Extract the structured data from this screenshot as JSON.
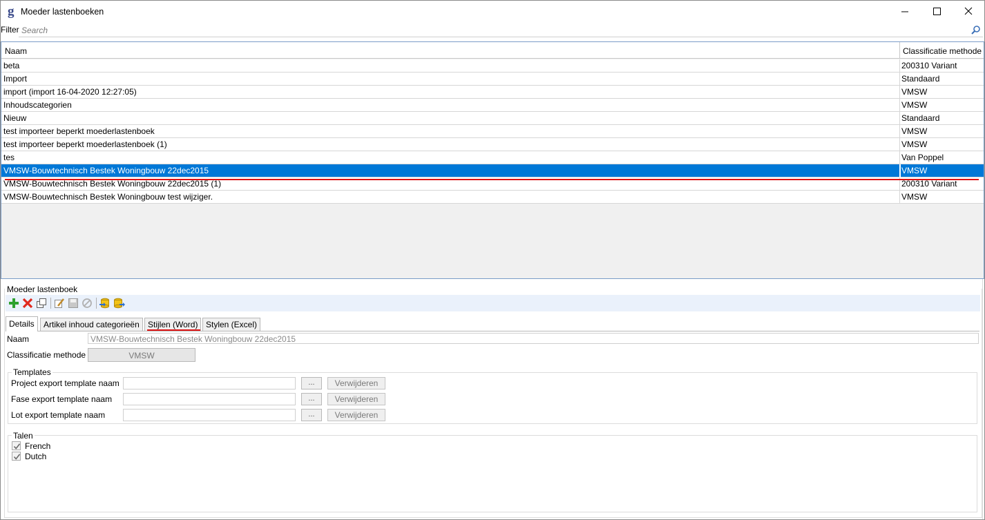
{
  "window": {
    "title": "Moeder lastenboeken"
  },
  "filter": {
    "label": "Filter",
    "placeholder": "Search"
  },
  "grid": {
    "columns": [
      "Naam",
      "Classificatie methode"
    ],
    "rows": [
      {
        "naam": "beta",
        "classificatie": "200310 Variant"
      },
      {
        "naam": "Import",
        "classificatie": "Standaard"
      },
      {
        "naam": "import (import 16-04-2020 12:27:05)",
        "classificatie": "VMSW"
      },
      {
        "naam": "Inhoudscategorien",
        "classificatie": "VMSW"
      },
      {
        "naam": "Nieuw",
        "classificatie": "Standaard"
      },
      {
        "naam": "test importeer beperkt moederlastenboek",
        "classificatie": "VMSW"
      },
      {
        "naam": "test importeer beperkt moederlastenboek (1)",
        "classificatie": "VMSW"
      },
      {
        "naam": "tes",
        "classificatie": "Van Poppel"
      },
      {
        "naam": "VMSW-Bouwtechnisch Bestek Woningbouw 22dec2015",
        "classificatie": "VMSW",
        "selected": true
      },
      {
        "naam": "VMSW-Bouwtechnisch Bestek Woningbouw 22dec2015 (1)",
        "classificatie": "200310 Variant"
      },
      {
        "naam": "VMSW-Bouwtechnisch Bestek Woningbouw test wijziger.",
        "classificatie": "VMSW"
      }
    ]
  },
  "detail_group": {
    "label": "Moeder lastenboek",
    "toolbar": [
      "add-icon",
      "delete-icon",
      "copy-icon",
      "edit-icon",
      "save-icon",
      "cancel-icon",
      "import-icon",
      "export-icon"
    ],
    "tabs": [
      "Details",
      "Artikel inhoud categorieën",
      "Stijlen (Word)",
      "Stylen (Excel)"
    ],
    "active_tab": "Details",
    "naam_label": "Naam",
    "naam_value": "VMSW-Bouwtechnisch Bestek Woningbouw 22dec2015",
    "klas_label": "Classificatie methode",
    "klas_value": "VMSW",
    "templates": {
      "label": "Templates",
      "rows": [
        {
          "label": "Project export template naam",
          "value": "",
          "browse": "...",
          "remove": "Verwijderen"
        },
        {
          "label": "Fase export template naam",
          "value": "",
          "browse": "...",
          "remove": "Verwijderen"
        },
        {
          "label": "Lot export template naam",
          "value": "",
          "browse": "...",
          "remove": "Verwijderen"
        }
      ]
    },
    "talen": {
      "label": "Talen",
      "items": [
        {
          "label": "French",
          "checked": true
        },
        {
          "label": "Dutch",
          "checked": true
        }
      ]
    }
  },
  "colors": {
    "selection": "#0078d7",
    "highlight_underline": "#dd1111",
    "toolbar_bg": "#eaf1fb"
  }
}
